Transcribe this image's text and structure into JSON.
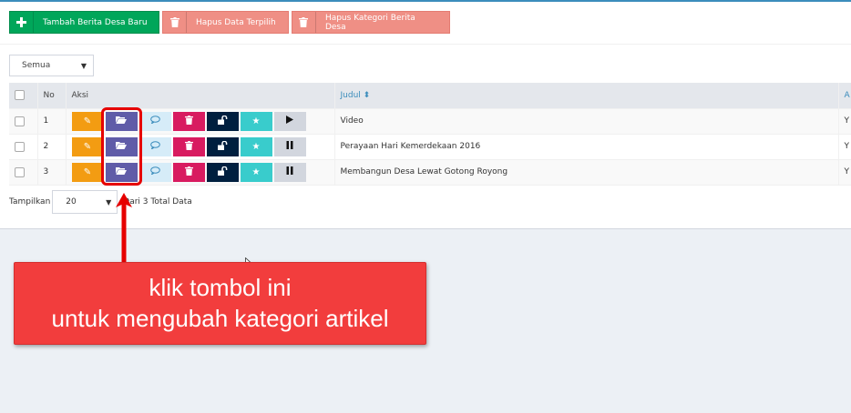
{
  "toolbar": {
    "add_label": "Tambah Berita Desa Baru",
    "delete_selected_label": "Hapus Data Terpilih",
    "delete_category_label": "Hapus Kategori Berita Desa"
  },
  "filter": {
    "selected": "Semua"
  },
  "table": {
    "headers": {
      "no": "No",
      "aksi": "Aksi",
      "judul": "Judul",
      "next": "A"
    },
    "rows": [
      {
        "no": "1",
        "title": "Video",
        "last_col": "Y",
        "media_icon": "play-icon"
      },
      {
        "no": "2",
        "title": "Perayaan Hari Kemerdekaan 2016",
        "last_col": "Y",
        "media_icon": "pause-icon"
      },
      {
        "no": "3",
        "title": "Membangun Desa Lewat Gotong Royong",
        "last_col": "Y",
        "media_icon": "pause-icon"
      }
    ]
  },
  "pager": {
    "show_label": "Tampilkan",
    "per_page": "20",
    "total_text": "Dari 3 Total Data"
  },
  "callout": {
    "line1": "klik tombol ini",
    "line2": "untuk mengubah kategori artikel"
  },
  "colors": {
    "green": "#00a65a",
    "red_muted": "#ef8f85",
    "orange": "#f39c12",
    "purple": "#605ca8",
    "pink": "#d81b60",
    "navy": "#001f3f",
    "teal": "#39cccc",
    "callout": "#f23d3d",
    "highlight": "#e60000"
  }
}
